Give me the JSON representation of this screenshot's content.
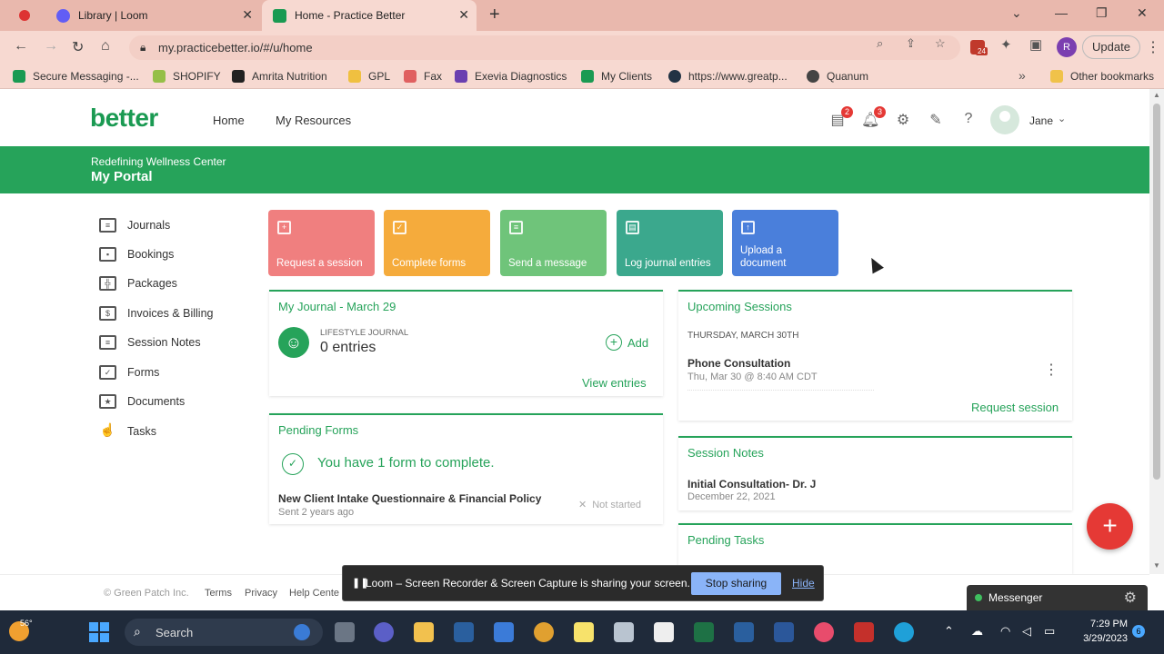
{
  "browser": {
    "tabs": [
      {
        "title": "Library | Loom",
        "active": false,
        "favicon_color": "#625df5"
      },
      {
        "title": "Home - Practice Better",
        "active": true,
        "favicon_color": "#1a9a52"
      }
    ],
    "url": "my.practicebetter.io/#/u/home",
    "update_label": "Update",
    "profile_initial": "R",
    "extension_badge": "24",
    "bookmarks": [
      {
        "label": "Secure Messaging -...",
        "color": "#1a9a52"
      },
      {
        "label": "SHOPIFY",
        "color": "#95bf47"
      },
      {
        "label": "Amrita Nutrition",
        "color": "#222"
      },
      {
        "label": "GPL",
        "color": "#f0c040"
      },
      {
        "label": "Fax",
        "color": "#e06060"
      },
      {
        "label": "Exevia Diagnostics",
        "color": "#6a3fb0"
      },
      {
        "label": "My Clients",
        "color": "#1a9a52"
      },
      {
        "label": "https://www.greatp...",
        "color": "#234"
      },
      {
        "label": "Quanum",
        "color": "#444"
      }
    ],
    "other_bookmarks": "Other bookmarks"
  },
  "header": {
    "logo": "better",
    "nav": [
      "Home",
      "My Resources"
    ],
    "messages_badge": "2",
    "notifications_badge": "3",
    "user_name": "Jane"
  },
  "banner": {
    "org": "Redefining Wellness Center",
    "portal": "My Portal"
  },
  "sidebar": {
    "items": [
      {
        "label": "Journals",
        "icon": "journal-icon"
      },
      {
        "label": "Bookings",
        "icon": "calendar-icon"
      },
      {
        "label": "Packages",
        "icon": "gift-icon"
      },
      {
        "label": "Invoices & Billing",
        "icon": "dollar-icon"
      },
      {
        "label": "Session Notes",
        "icon": "notes-icon"
      },
      {
        "label": "Forms",
        "icon": "checklist-icon"
      },
      {
        "label": "Documents",
        "icon": "star-folder-icon"
      },
      {
        "label": "Tasks",
        "icon": "hand-pointer-icon"
      }
    ]
  },
  "actions": [
    {
      "label": "Request a session",
      "color": "#f07f7f",
      "icon": "calendar-plus-icon"
    },
    {
      "label": "Complete forms",
      "color": "#f5ab3c",
      "icon": "clipboard-check-icon"
    },
    {
      "label": "Send a message",
      "color": "#6fc47a",
      "icon": "chat-icon"
    },
    {
      "label": "Log journal entries",
      "color": "#3ba88d",
      "icon": "journal-icon"
    },
    {
      "label": "Upload a document",
      "color": "#4a7fdb",
      "icon": "file-upload-icon"
    }
  ],
  "journal": {
    "title": "My Journal - March 29",
    "journal_type": "LIFESTYLE JOURNAL",
    "entries": "0 entries",
    "add_label": "Add",
    "view_label": "View entries"
  },
  "pending_forms": {
    "title": "Pending Forms",
    "summary": "You have 1 form to complete.",
    "form_name": "New Client Intake Questionnaire & Financial Policy",
    "sent": "Sent 2 years ago",
    "status": "Not started"
  },
  "upcoming": {
    "title": "Upcoming Sessions",
    "date_header": "THURSDAY, MARCH 30TH",
    "session_name": "Phone Consultation",
    "session_time": "Thu, Mar 30 @ 8:40 AM CDT",
    "request_label": "Request session"
  },
  "session_notes": {
    "title": "Session Notes",
    "note_name": "Initial Consultation- Dr. J",
    "note_date": "December 22, 2021"
  },
  "pending_tasks": {
    "title": "Pending Tasks"
  },
  "footer": {
    "copyright": "© Green Patch Inc.",
    "links": [
      "Terms",
      "Privacy",
      "Help Cente"
    ]
  },
  "loom": {
    "message": "Loom – Screen Recorder & Screen Capture is sharing your screen.",
    "stop_label": "Stop sharing",
    "hide_label": "Hide"
  },
  "messenger": {
    "label": "Messenger"
  },
  "taskbar": {
    "temperature": "56°",
    "search_label": "Search",
    "time": "7:29 PM",
    "date": "3/29/2023",
    "notification_count": "6"
  }
}
